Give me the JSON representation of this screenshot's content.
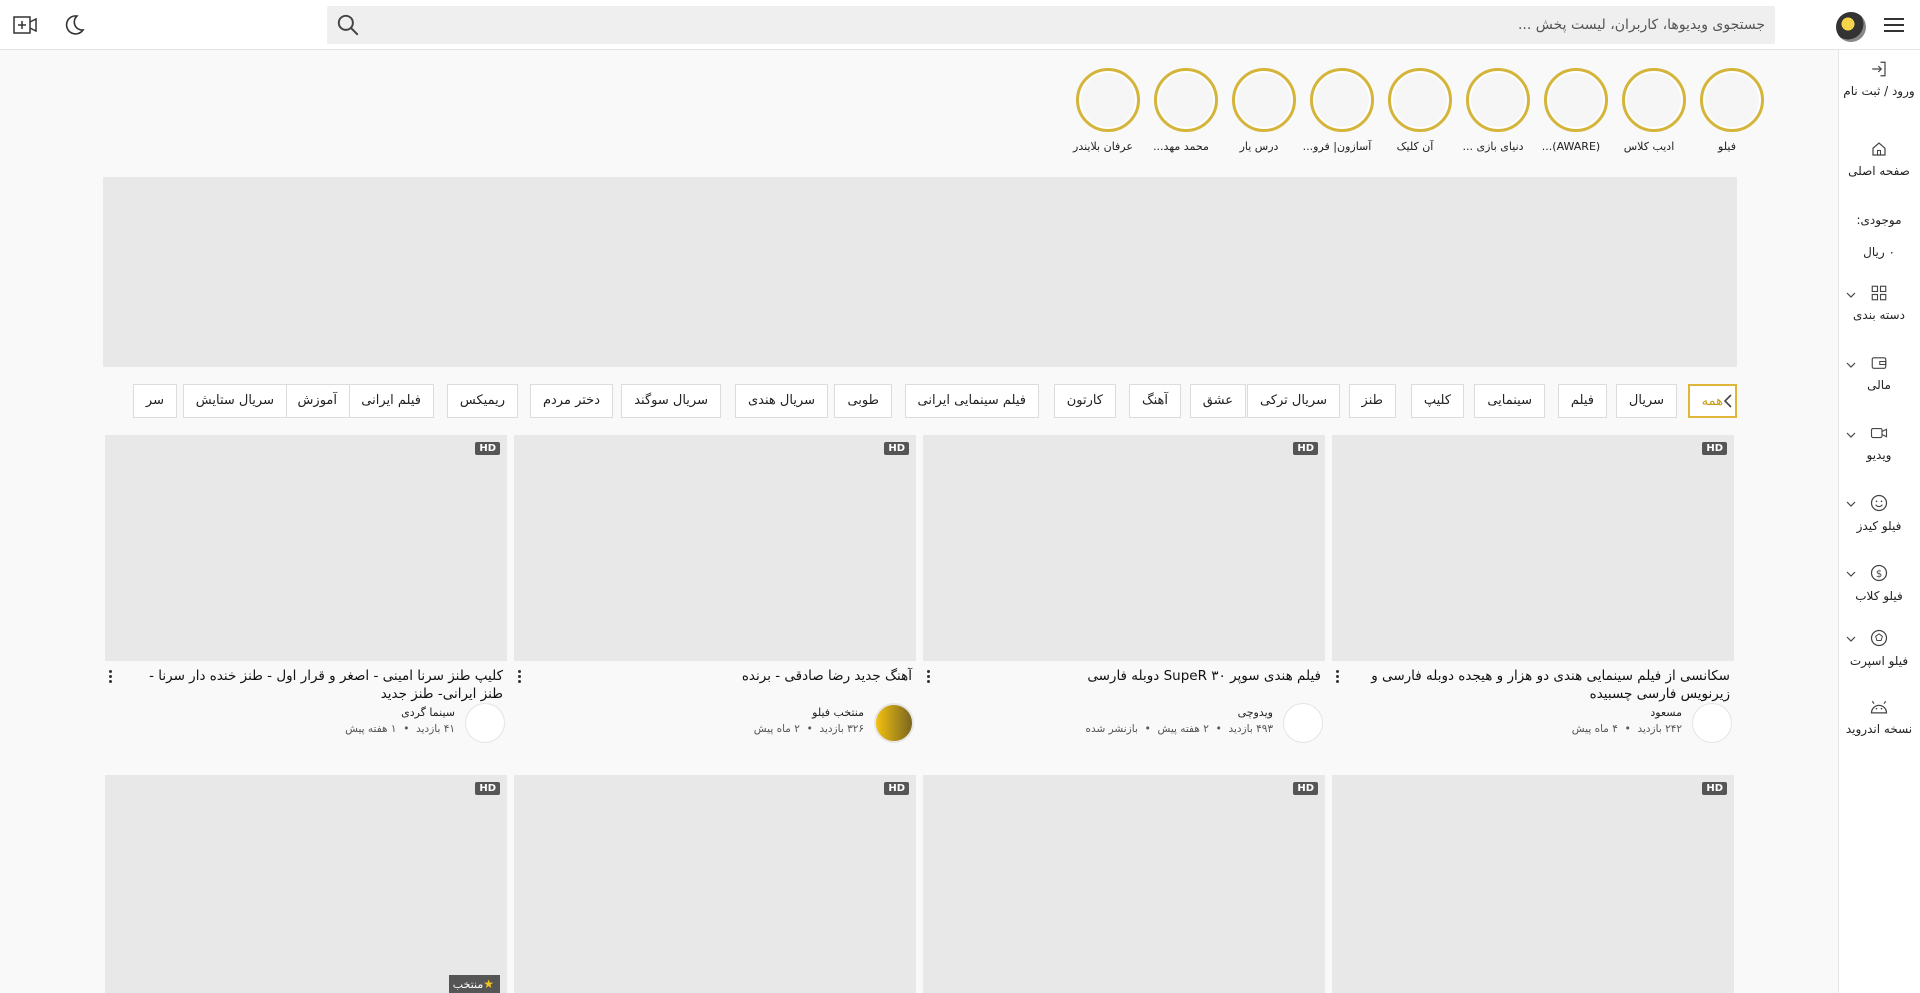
{
  "search": {
    "placeholder": "جستجوی ویدیوها، کاربران، لیست پخش ..."
  },
  "sidebar": {
    "items": [
      {
        "label": "ورود / ثبت نام",
        "icon": "login-icon"
      },
      {
        "label": "صفحه اصلی",
        "icon": "home-icon"
      },
      {
        "label": "موجودی:",
        "icon": ""
      },
      {
        "label": "۰ ریال",
        "icon": ""
      },
      {
        "label": "دسته بندی",
        "icon": "categories-icon"
      },
      {
        "label": "مالی",
        "icon": "wallet-icon"
      },
      {
        "label": "ویدیو",
        "icon": "video-icon"
      },
      {
        "label": "فیلو کیدز",
        "icon": "kids-icon"
      },
      {
        "label": "فیلو کلاب",
        "icon": "club-icon"
      },
      {
        "label": "فیلو اسپرت",
        "icon": "sport-icon"
      },
      {
        "label": "نسخه اندروید",
        "icon": "android-icon"
      }
    ]
  },
  "stories": [
    {
      "label": "فیلو"
    },
    {
      "label": "ادیب کلاس"
    },
    {
      "label": "(AWARE)..."
    },
    {
      "label": "دنیای بازی ..."
    },
    {
      "label": "آن کلیک"
    },
    {
      "label": "آسازون| فرو..."
    },
    {
      "label": "درس یار"
    },
    {
      "label": "محمد مهد..."
    },
    {
      "label": "عرفان بلایندر"
    }
  ],
  "chips": [
    "همه",
    "سریال",
    "فیلم",
    "سینمایی",
    "کلیپ",
    "طنز",
    "سریال ترکی",
    "عشق",
    "آهنگ",
    "کارتون",
    "فیلم سینمایی ایرانی",
    "طوبی",
    "سریال هندی",
    "سریال سوگند",
    "دختر مردم",
    "ریمیکس",
    "فیلم ایرانی",
    "آموزش",
    "سریال ستایش",
    "سر"
  ],
  "videos": [
    {
      "title": "سکانسی از فیلم سینمایی هندی دو هزار و هیجده دوبله فارسی و زیرنویس فارسی چسبیده",
      "channel": "مسعود",
      "views": "۲۴۲ بازدید",
      "time": "۴ ماه پیش",
      "extra": "",
      "hd": "HD"
    },
    {
      "title": "فیلم هندی سوپر ۳۰ SupeR دوبله فارسی",
      "channel": "ویدوچی",
      "views": "۴۹۳ بازدید",
      "time": "۲ هفته پیش",
      "extra": "بازنشر شده",
      "hd": "HD"
    },
    {
      "title": "آهنگ جدید رضا صادقی - برنده",
      "channel": "منتخب فیلو",
      "views": "۳۲۶ بازدید",
      "time": "۲ ماه پیش",
      "extra": "",
      "hd": "HD"
    },
    {
      "title": "کلیپ طنز سرنا امینی - اصغر و قرار اول - طنز خنده دار سرنا - طنز ایرانی- طنز جدید",
      "channel": "سینما گردی",
      "views": "۴۱ بازدید",
      "time": "۱ هفته پیش",
      "extra": "",
      "hd": "HD"
    }
  ],
  "row2": [
    {
      "hd": "HD"
    },
    {
      "hd": "HD"
    },
    {
      "hd": "HD"
    },
    {
      "hd": "HD",
      "badge": "منتخب"
    }
  ]
}
